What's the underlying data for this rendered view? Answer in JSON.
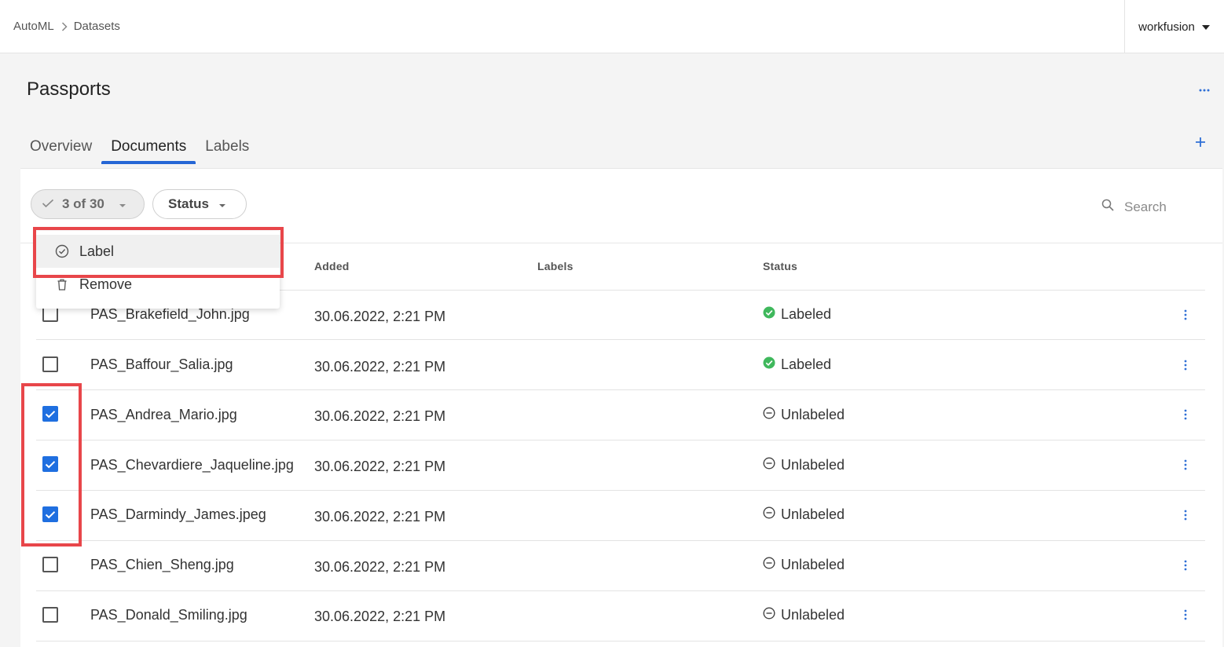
{
  "breadcrumb": {
    "root": "AutoML",
    "current": "Datasets"
  },
  "account": {
    "name": "workfusion"
  },
  "page": {
    "title": "Passports"
  },
  "tabs": [
    {
      "label": "Overview",
      "active": false
    },
    {
      "label": "Documents",
      "active": true
    },
    {
      "label": "Labels",
      "active": false
    }
  ],
  "toolbar": {
    "selection_label": "3 of 30",
    "status_filter_label": "Status",
    "search_placeholder": "Search"
  },
  "selection_menu": {
    "items": [
      {
        "label": "Label",
        "icon": "check-circle-icon"
      },
      {
        "label": "Remove",
        "icon": "trash-icon"
      }
    ]
  },
  "table": {
    "columns": [
      "Added",
      "Labels",
      "Status"
    ],
    "rows": [
      {
        "name": "PAS_Brakefield_John.jpg",
        "added": "30.06.2022, 2:21 PM",
        "labels": "",
        "status": "Labeled",
        "checked": false
      },
      {
        "name": "PAS_Baffour_Salia.jpg",
        "added": "30.06.2022, 2:21 PM",
        "labels": "",
        "status": "Labeled",
        "checked": false
      },
      {
        "name": "PAS_Andrea_Mario.jpg",
        "added": "30.06.2022, 2:21 PM",
        "labels": "",
        "status": "Unlabeled",
        "checked": true
      },
      {
        "name": "PAS_Chevardiere_Jaqueline.jpg",
        "added": "30.06.2022, 2:21 PM",
        "labels": "",
        "status": "Unlabeled",
        "checked": true
      },
      {
        "name": "PAS_Darmindy_James.jpeg",
        "added": "30.06.2022, 2:21 PM",
        "labels": "",
        "status": "Unlabeled",
        "checked": true
      },
      {
        "name": "PAS_Chien_Sheng.jpg",
        "added": "30.06.2022, 2:21 PM",
        "labels": "",
        "status": "Unlabeled",
        "checked": false
      },
      {
        "name": "PAS_Donald_Smiling.jpg",
        "added": "30.06.2022, 2:21 PM",
        "labels": "",
        "status": "Unlabeled",
        "checked": false
      }
    ]
  },
  "colors": {
    "accent": "#2566d5",
    "checkbox_checked": "#1f6fe0",
    "labeled_status": "#3fb85c",
    "annotation_highlight": "#e8464a"
  }
}
